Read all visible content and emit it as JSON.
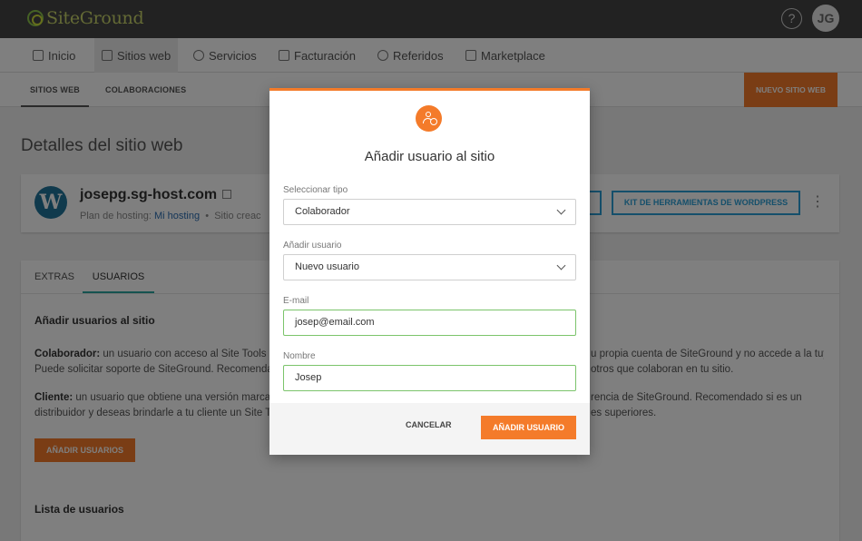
{
  "app": {
    "logo_text": "SiteGround",
    "help_symbol": "?",
    "avatar_initials": "JG"
  },
  "main_nav": [
    {
      "label": "Inicio",
      "icon": "grid-icon"
    },
    {
      "label": "Sitios web",
      "icon": "sites-icon",
      "active": true
    },
    {
      "label": "Servicios",
      "icon": "services-icon"
    },
    {
      "label": "Facturación",
      "icon": "billing-icon"
    },
    {
      "label": "Referidos",
      "icon": "referrals-icon"
    },
    {
      "label": "Marketplace",
      "icon": "marketplace-icon"
    }
  ],
  "sub_nav": {
    "tab_sites": "SITIOS WEB",
    "tab_collab": "COLABORACIONES",
    "new_site": "NUEVO SITIO WEB"
  },
  "page": {
    "title": "Detalles del sitio web"
  },
  "site": {
    "name": "josepg.sg-host.com",
    "plan_label": "Plan de hosting:",
    "plan_value": "Mi hosting",
    "separator": "•",
    "created_label": "Sitio creac",
    "toolkit_button": "KIT DE HERRAMIENTAS DE WORDPRESS",
    "more_symbol": "⋮"
  },
  "panel": {
    "tab_extras": "EXTRAS",
    "tab_users": "USUARIOS",
    "heading": "Añadir usuarios al sitio",
    "collab_term": "Colaborador:",
    "collab_line1_start": " un usuario con acceso al Site Tools de",
    "collab_line1_end": "u propia cuenta de SiteGround y no accede a la tuya.",
    "collab_line2_start": "Puede solicitar soporte de SiteGround. Recomendado",
    "collab_line2_end": "otros que colaboran en tu sitio.",
    "client_term": "Cliente:",
    "client_line1_start": " un usuario que obtiene una versión marca b",
    "client_line1_end": "rencia de SiteGround. Recomendado si es un",
    "client_line2_start": "distribuidor y deseas brindarle a tu cliente un Site To",
    "client_line2_end": "es superiores.",
    "add_button": "AÑADIR USUARIOS",
    "list_heading": "Lista de usuarios"
  },
  "modal": {
    "title": "Añadir usuario al sitio",
    "type_label": "Seleccionar tipo",
    "type_value": "Colaborador",
    "user_label": "Añadir usuario",
    "user_value": "Nuevo usuario",
    "email_label": "E-mail",
    "email_value": "josep@email.com",
    "name_label": "Nombre",
    "name_value": "Josep",
    "cancel": "CANCELAR",
    "submit": "AÑADIR USUARIO"
  },
  "colors": {
    "accent": "#f47b2a",
    "topbar": "#454545",
    "valid_border": "#7bc46b",
    "link_blue": "#2a9fd6"
  }
}
